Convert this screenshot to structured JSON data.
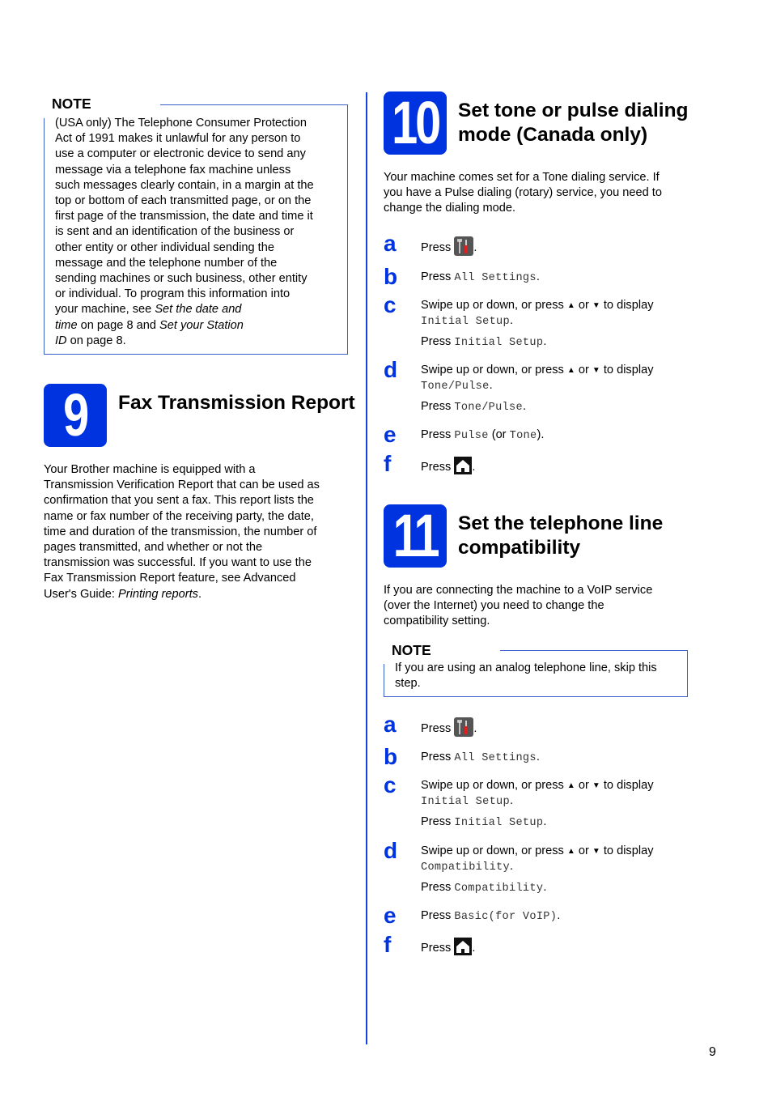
{
  "page_number": "9",
  "left_column": {
    "note": {
      "title": "NOTE",
      "lines": [
        "(USA only) The Telephone Consumer Protection",
        "Act of 1991 makes it unlawful for any person to",
        "use a computer or electronic device to send any",
        "message via a telephone fax machine unless",
        "such messages clearly contain, in a margin at the",
        "top or bottom of each transmitted page, or on the",
        "first page of the transmission, the date and time it",
        "is sent and an identification of the business or",
        "other entity or other individual sending the",
        "message and the telephone number of the",
        "sending machines or such business, other entity",
        "or individual. To program this information into"
      ],
      "line13_pre": "your machine, see ",
      "line13_italic": "Set the date and",
      "line14_italic1": "time",
      "line14_mid": " on page 8 and ",
      "line14_italic2": "Set your Station",
      "line15_italic": "ID",
      "line15_post": " on page 8."
    },
    "section9": {
      "number": "9",
      "title": "Fax Transmission Report",
      "lines": [
        "Your Brother machine is equipped with a",
        "Transmission Verification Report that can be used as",
        "confirmation that you sent a fax. This report lists the",
        "name or fax number of the receiving party, the date,",
        "time and duration of the transmission, the number of",
        "pages transmitted, and whether or not the",
        "transmission was successful. If you want to use the",
        "Fax Transmission Report feature, see Advanced"
      ],
      "last_line_pre": "User's Guide: ",
      "last_line_italic": "Printing reports",
      "last_line_post": "."
    }
  },
  "right_column": {
    "section10": {
      "number": "10",
      "title_line1": "Set tone or pulse dialing",
      "title_line2": "mode (Canada only)",
      "intro": [
        "Your machine comes set for a Tone dialing service. If",
        "you have a Pulse dialing (rotary) service, you need to",
        "change the dialing mode."
      ],
      "steps": {
        "a": {
          "letter": "a",
          "press": "Press ",
          "icon": "settings-tools-icon",
          "post": "."
        },
        "b": {
          "letter": "b",
          "press": "Press ",
          "code": "All Settings",
          "post": "."
        },
        "c": {
          "letter": "c",
          "swipe": "Swipe up or down, or press ",
          "up": "▲",
          "or": " or ",
          "down": "▼",
          "to_display": " to display",
          "code1": "Initial Setup",
          "post1": ".",
          "press": "Press ",
          "code2": "Initial Setup",
          "post2": "."
        },
        "d": {
          "letter": "d",
          "swipe": "Swipe up or down, or press ",
          "up": "▲",
          "or": " or ",
          "down": "▼",
          "to_display": " to display",
          "code1": "Tone/Pulse",
          "post1": ".",
          "press": "Press ",
          "code2": "Tone/Pulse",
          "post2": "."
        },
        "e": {
          "letter": "e",
          "press": "Press ",
          "code1": "Pulse",
          "mid": " (or ",
          "code2": "Tone",
          "post": ")."
        },
        "f": {
          "letter": "f",
          "press": "Press ",
          "icon": "home-icon",
          "post": "."
        }
      }
    },
    "section11": {
      "number": "11",
      "title_line1": "Set the telephone line",
      "title_line2": "compatibility",
      "intro": [
        "If you are connecting the machine to a VoIP service",
        "(over the Internet) you need to change the",
        "compatibility setting."
      ],
      "note": {
        "title": "NOTE",
        "lines": [
          "If you are using an analog telephone line, skip this",
          "step."
        ]
      },
      "steps": {
        "a": {
          "letter": "a",
          "press": "Press ",
          "icon": "settings-tools-icon",
          "post": "."
        },
        "b": {
          "letter": "b",
          "press": "Press ",
          "code": "All Settings",
          "post": "."
        },
        "c": {
          "letter": "c",
          "swipe": "Swipe up or down, or press ",
          "up": "▲",
          "or": " or ",
          "down": "▼",
          "to_display": " to display",
          "code1": "Initial Setup",
          "post1": ".",
          "press": "Press ",
          "code2": "Initial Setup",
          "post2": "."
        },
        "d": {
          "letter": "d",
          "swipe": "Swipe up or down, or press ",
          "up": "▲",
          "or": " or ",
          "down": "▼",
          "to_display": " to display",
          "code1": "Compatibility",
          "post1": ".",
          "press": "Press ",
          "code2": "Compatibility",
          "post2": "."
        },
        "e": {
          "letter": "e",
          "press": "Press ",
          "code": "Basic(for VoIP)",
          "post": "."
        },
        "f": {
          "letter": "f",
          "press": "Press ",
          "icon": "home-icon",
          "post": "."
        }
      }
    }
  },
  "colors": {
    "accent_blue": "#0033e0",
    "note_border": "#3a5fcd",
    "divider": "#1245e0"
  }
}
